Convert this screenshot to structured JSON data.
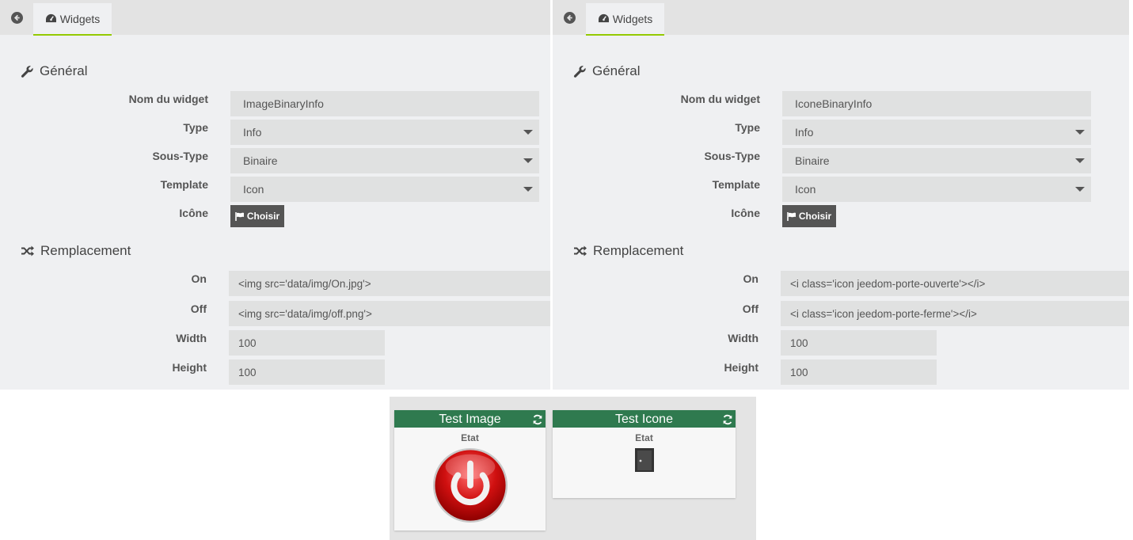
{
  "left_panel": {
    "tab_label": "Widgets",
    "general_title": "Général",
    "fields": {
      "name_label": "Nom du widget",
      "name_value": "ImageBinaryInfo",
      "type_label": "Type",
      "type_value": "Info",
      "subtype_label": "Sous-Type",
      "subtype_value": "Binaire",
      "template_label": "Template",
      "template_value": "Icon",
      "icon_label": "Icône",
      "choose_label": "Choisir"
    },
    "replacement_title": "Remplacement",
    "replacement": {
      "on_label": "On",
      "on_value": "<img src='data/img/On.jpg'>",
      "off_label": "Off",
      "off_value": "<img src='data/img/off.png'>",
      "width_label": "Width",
      "width_value": "100",
      "height_label": "Height",
      "height_value": "100"
    }
  },
  "right_panel": {
    "tab_label": "Widgets",
    "general_title": "Général",
    "fields": {
      "name_label": "Nom du widget",
      "name_value": "IconeBinaryInfo",
      "type_label": "Type",
      "type_value": "Info",
      "subtype_label": "Sous-Type",
      "subtype_value": "Binaire",
      "template_label": "Template",
      "template_value": "Icon",
      "icon_label": "Icône",
      "choose_label": "Choisir"
    },
    "replacement_title": "Remplacement",
    "replacement": {
      "on_label": "On",
      "on_value": "<i class='icon jeedom-porte-ouverte'></i>",
      "off_label": "Off",
      "off_value": "<i class='icon jeedom-porte-ferme'></i>",
      "width_label": "Width",
      "width_value": "100",
      "height_label": "Height",
      "height_value": "100"
    }
  },
  "preview": {
    "widget_image": {
      "title": "Test Image",
      "state_label": "Etat",
      "icon": "power-button-icon"
    },
    "widget_icon": {
      "title": "Test Icone",
      "state_label": "Etat",
      "icon": "door-closed-icon"
    }
  },
  "colors": {
    "panel_bg": "#eff0f2",
    "tab_accent": "#94ca02",
    "input_bg": "#e0e1e1",
    "button_bg": "#555555",
    "widget_header": "#2f7a4f",
    "power_red": "#d01010"
  }
}
